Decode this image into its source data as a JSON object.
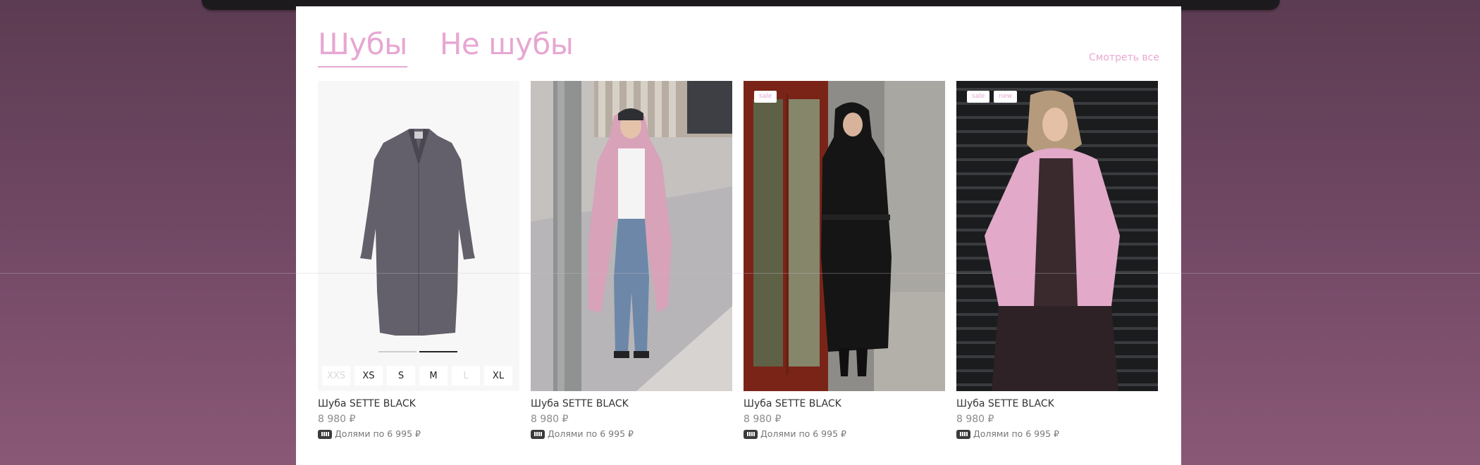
{
  "tabs": [
    {
      "label": "Шубы",
      "active": true
    },
    {
      "label": "Не шубы",
      "active": false
    }
  ],
  "view_all": "Смотреть все",
  "colors": {
    "accent": "#e7a7d2",
    "background": "#6f4763",
    "panel": "#ffffff",
    "split_icon": "#3b3b3b"
  },
  "products": [
    {
      "name": "Шуба SETTE BLACK",
      "price": "8 980 ₽",
      "split": "Долями по 6 995 ₽",
      "badges": [],
      "image": "gray-faux-fur-coat-product-photo",
      "sizes": [
        {
          "label": "XXS",
          "available": false
        },
        {
          "label": "XS",
          "available": true
        },
        {
          "label": "S",
          "available": true
        },
        {
          "label": "M",
          "available": true
        },
        {
          "label": "L",
          "available": false
        },
        {
          "label": "XL",
          "available": true
        }
      ],
      "gallery_dots": 2,
      "gallery_active": 2
    },
    {
      "name": "Шуба SETTE BLACK",
      "price": "8 980 ₽",
      "split": "Долями по 6 995 ₽",
      "badges": [],
      "image": "woman-in-pink-shaggy-fur-coat-street"
    },
    {
      "name": "Шуба SETTE BLACK",
      "price": "8 980 ₽",
      "split": "Долями по 6 995 ₽",
      "badges": [
        "sale"
      ],
      "image": "woman-in-black-hooded-fur-coat-at-red-door"
    },
    {
      "name": "Шуба SETTE BLACK",
      "price": "8 980 ₽",
      "split": "Долями по 6 995 ₽",
      "badges": [
        "sale",
        "new"
      ],
      "image": "woman-in-pink-shaggy-fur-jacket-dark-shutter"
    }
  ]
}
